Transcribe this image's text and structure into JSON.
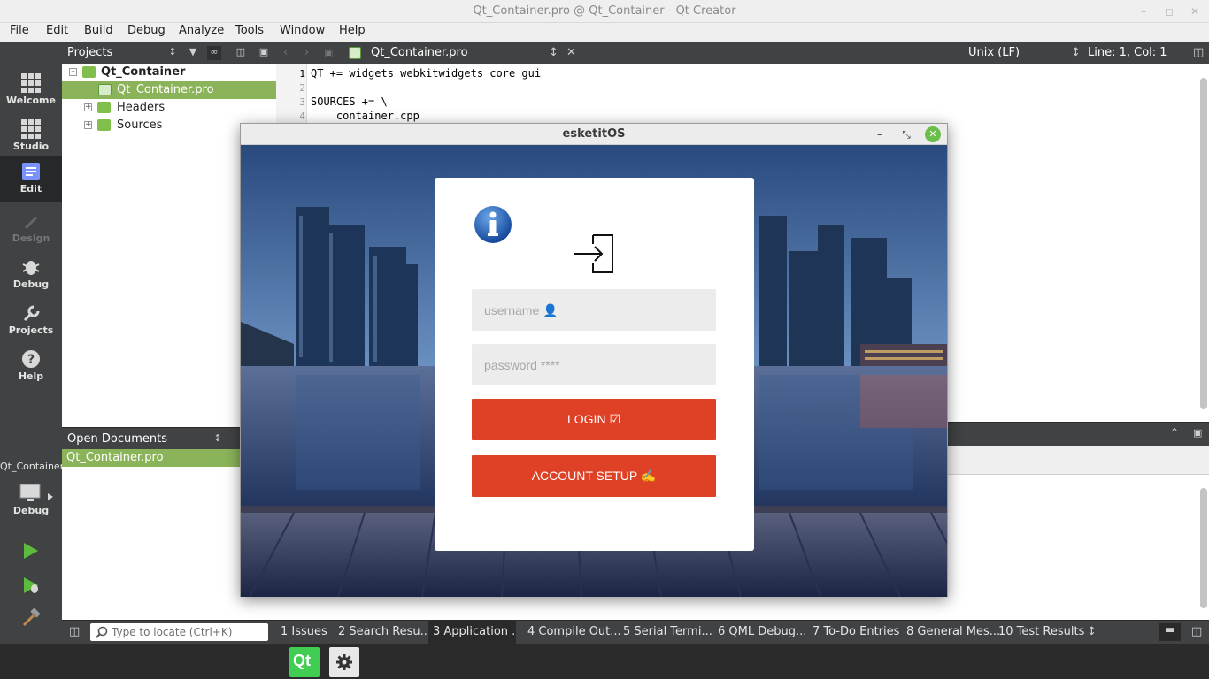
{
  "window": {
    "title": "Qt_Container.pro @ Qt_Container - Qt Creator",
    "controls": [
      "minimize",
      "maximize",
      "close"
    ]
  },
  "menubar": [
    "File",
    "Edit",
    "Build",
    "Debug",
    "Analyze",
    "Tools",
    "Window",
    "Help"
  ],
  "modes": [
    {
      "label": "Welcome",
      "icon": "grid-icon",
      "active": false,
      "enabled": true
    },
    {
      "label": "Studio",
      "icon": "grid-icon",
      "active": false,
      "enabled": true
    },
    {
      "label": "Edit",
      "icon": "document-icon",
      "active": true,
      "enabled": true
    },
    {
      "label": "Design",
      "icon": "pencil-icon",
      "active": false,
      "enabled": false
    },
    {
      "label": "Debug",
      "icon": "bug-icon",
      "active": false,
      "enabled": true
    },
    {
      "label": "Projects",
      "icon": "wrench-icon",
      "active": false,
      "enabled": true
    },
    {
      "label": "Help",
      "icon": "question-icon",
      "active": false,
      "enabled": true
    }
  ],
  "kit": {
    "project": "Qt_Container",
    "config": "Debug"
  },
  "projects_panel": {
    "title": "Projects",
    "tree": [
      {
        "label": "Qt_Container",
        "level": 0,
        "expanded": true,
        "bold": true,
        "selected": false
      },
      {
        "label": "Qt_Container.pro",
        "level": 1,
        "selected": true
      },
      {
        "label": "Headers",
        "level": 1,
        "expanded": false,
        "selected": false
      },
      {
        "label": "Sources",
        "level": 1,
        "expanded": false,
        "selected": false
      }
    ]
  },
  "open_documents": {
    "title": "Open Documents",
    "items": [
      "Qt_Container.pro"
    ]
  },
  "editor": {
    "file": "Qt_Container.pro",
    "line_ending": "Unix (LF)",
    "position": "Line: 1, Col: 1",
    "lines": [
      {
        "n": "1",
        "text": "QT += widgets webkitwidgets core gui"
      },
      {
        "n": "2",
        "text": ""
      },
      {
        "n": "3",
        "text": "SOURCES += \\"
      },
      {
        "n": "4",
        "text": "    container.cpp"
      }
    ]
  },
  "output_tabs": {
    "locate_placeholder": "Type to locate (Ctrl+K)",
    "tabs": [
      "1  Issues",
      "2  Search Resu...",
      "3  Application ...",
      "4  Compile Out...",
      "5  Serial Termi...",
      "6  QML Debug...",
      "7  To-Do Entries",
      "8  General Mes...",
      "10 Test Results"
    ],
    "active_index": 2
  },
  "taskbar": {
    "items": [
      "qt-creator-icon",
      "settings-icon"
    ]
  },
  "app": {
    "title": "esketitOS",
    "username_placeholder": "username 👤",
    "password_placeholder": "password ****",
    "login_label": "LOGIN ☑",
    "setup_label": "ACCOUNT SETUP ✍",
    "colors": {
      "button": "#de4125",
      "card": "#ffffff",
      "field": "#ececec",
      "info_icon": "#1f5fae"
    }
  }
}
